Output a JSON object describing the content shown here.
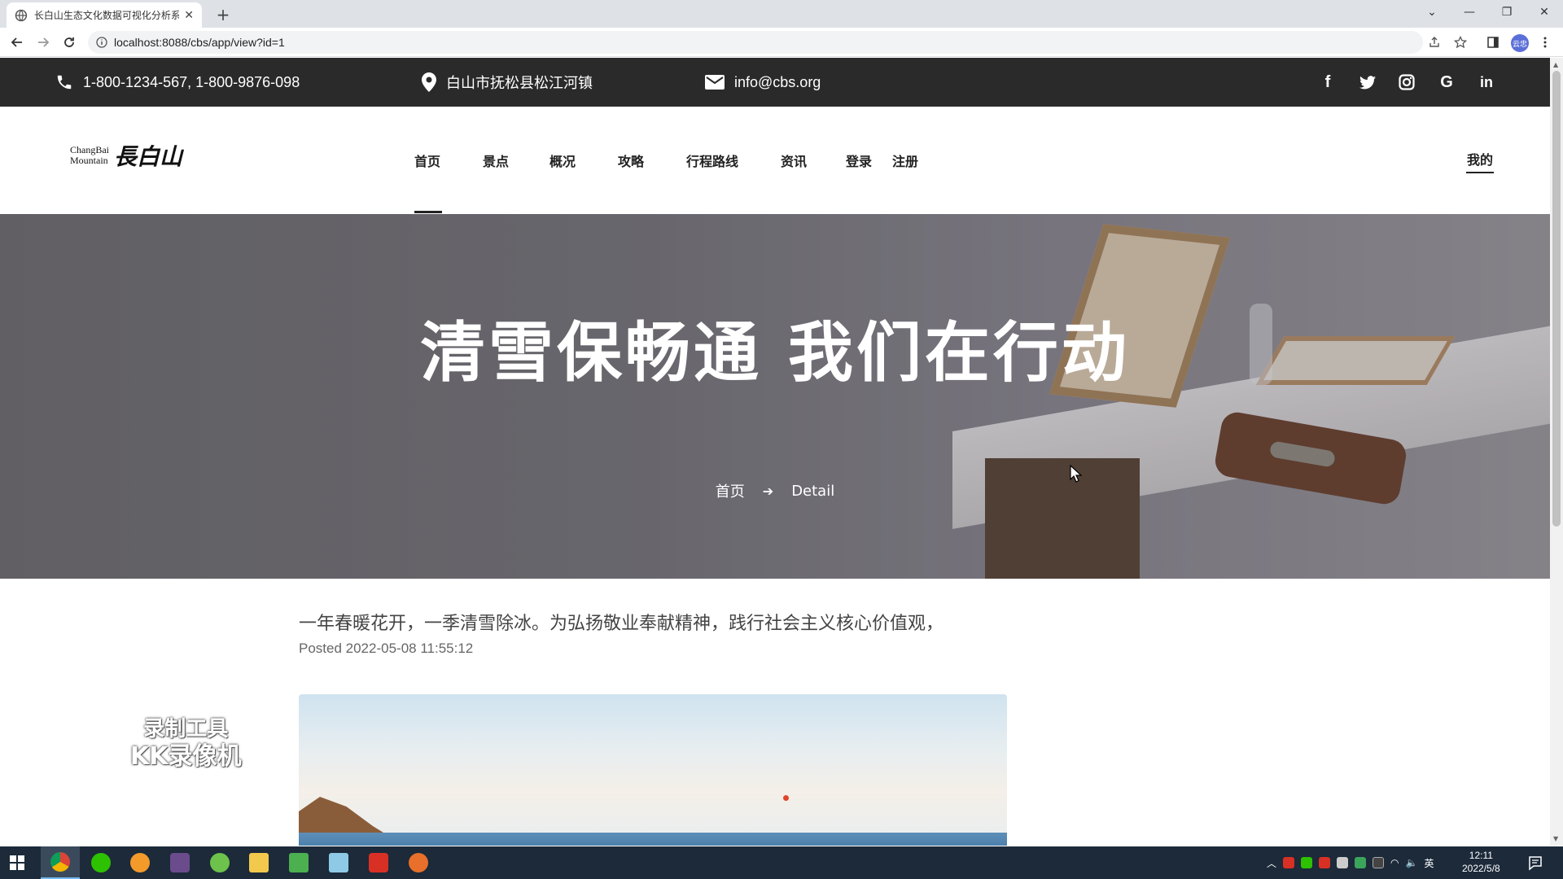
{
  "browser": {
    "tab_title": "长白山生态文化数据可视化分析系",
    "url": "localhost:8088/cbs/app/view?id=1",
    "profile_label": "云忠"
  },
  "topbar": {
    "phone": "1-800-1234-567, 1-800-9876-098",
    "address": "白山市抚松县松江河镇",
    "email": "info@cbs.org",
    "social": [
      "facebook-icon",
      "twitter-icon",
      "instagram-icon",
      "google-icon",
      "linkedin-icon"
    ]
  },
  "header": {
    "logo_en_1": "ChangBai",
    "logo_en_2": "Mountain",
    "logo_cn": "長白山",
    "nav": [
      "首页",
      "景点",
      "概况",
      "攻略",
      "行程路线",
      "资讯",
      "登录",
      "注册"
    ],
    "active_nav": "首页",
    "mine": "我的"
  },
  "hero": {
    "title": "清雪保畅通 我们在行动",
    "breadcrumb_home": "首页",
    "breadcrumb_current": "Detail"
  },
  "article": {
    "lead": "一年春暖花开，一季清雪除冰。为弘扬敬业奉献精神，践行社会主义核心价值观，",
    "posted": "Posted 2022-05-08 11:55:12"
  },
  "watermark": {
    "line1": "录制工具",
    "line2": "KK录像机"
  },
  "taskbar": {
    "time": "12:11",
    "date": "2022/5/8",
    "ime": "英"
  },
  "colors": {
    "topbar_bg": "#2a2a2a",
    "taskbar_bg": "#1c2a3a",
    "accent_underline": "#222222"
  }
}
